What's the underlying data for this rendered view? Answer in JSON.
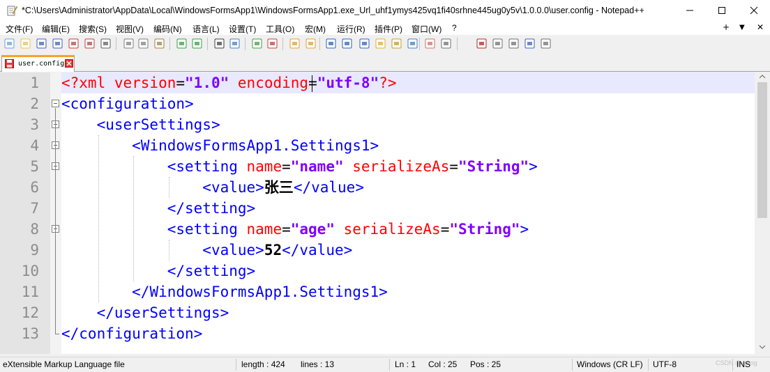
{
  "window": {
    "title": "*C:\\Users\\Administrator\\AppData\\Local\\WindowsFormsApp1\\WindowsFormsApp1.exe_Url_uhf1ymys425vq1fi40srhne445ug0y5v\\1.0.0.0\\user.config - Notepad++"
  },
  "menu": {
    "items": [
      "文件(F)",
      "编辑(E)",
      "搜索(S)",
      "视图(V)",
      "编码(N)",
      "语言(L)",
      "设置(T)",
      "工具(O)",
      "宏(M)",
      "运行(R)",
      "插件(P)",
      "窗口(W)",
      "?"
    ],
    "right_plus": "+",
    "right_arrow": "▼",
    "right_close": "✕"
  },
  "toolbar": {
    "icons": [
      "new-file-icon",
      "open-file-icon",
      "save-icon",
      "save-all-icon",
      "close-icon",
      "close-all-icon",
      "print-icon",
      "cut-icon",
      "copy-icon",
      "paste-icon",
      "undo-icon",
      "redo-icon",
      "find-icon",
      "replace-icon",
      "zoom-in-icon",
      "zoom-out-icon",
      "sync-vertical-icon",
      "sync-horizontal-icon",
      "word-wrap-icon",
      "show-all-chars-icon",
      "indent-guide-icon",
      "user-lang-icon",
      "doc-map-icon",
      "function-list-icon",
      "folder-workspace-icon",
      "monitoring-icon",
      "record-macro-icon",
      "stop-macro-icon",
      "play-macro-icon",
      "run-macro-multiple-icon",
      "save-macro-icon"
    ]
  },
  "tab": {
    "label": "user.config",
    "modified": true
  },
  "editor": {
    "line_numbers": [
      "1",
      "2",
      "3",
      "4",
      "5",
      "6",
      "7",
      "8",
      "9",
      "10",
      "11",
      "12",
      "13"
    ],
    "current_line": 1,
    "lines": [
      [
        [
          "a",
          "<?xml "
        ],
        [
          "a",
          "version"
        ],
        [
          "d",
          "="
        ],
        [
          "v",
          "\"1.0\""
        ],
        [
          "d",
          " "
        ],
        [
          "a",
          "enco"
        ],
        [
          "a",
          "ding"
        ],
        [
          "d",
          "="
        ],
        [
          "v",
          "\"utf-8\""
        ],
        [
          "a",
          "?>"
        ]
      ],
      [
        [
          "t",
          "<configuration>"
        ]
      ],
      [
        [
          "d",
          "    "
        ],
        [
          "t",
          "<userSettings>"
        ]
      ],
      [
        [
          "d",
          "        "
        ],
        [
          "t",
          "<WindowsFormsApp1.Settings1>"
        ]
      ],
      [
        [
          "d",
          "            "
        ],
        [
          "t",
          "<setting "
        ],
        [
          "a",
          "name"
        ],
        [
          "d",
          "="
        ],
        [
          "v",
          "\"name\""
        ],
        [
          "d",
          " "
        ],
        [
          "a",
          "serializeAs"
        ],
        [
          "d",
          "="
        ],
        [
          "v",
          "\"String\""
        ],
        [
          "t",
          ">"
        ]
      ],
      [
        [
          "d",
          "                "
        ],
        [
          "t",
          "<value>"
        ],
        [
          "x",
          "张三"
        ],
        [
          "t",
          "</value>"
        ]
      ],
      [
        [
          "d",
          "            "
        ],
        [
          "t",
          "</setting>"
        ]
      ],
      [
        [
          "d",
          "            "
        ],
        [
          "t",
          "<setting "
        ],
        [
          "a",
          "name"
        ],
        [
          "d",
          "="
        ],
        [
          "v",
          "\"age\""
        ],
        [
          "d",
          " "
        ],
        [
          "a",
          "serializeAs"
        ],
        [
          "d",
          "="
        ],
        [
          "v",
          "\"String\""
        ],
        [
          "t",
          ">"
        ]
      ],
      [
        [
          "d",
          "                "
        ],
        [
          "t",
          "<value>"
        ],
        [
          "x",
          "52"
        ],
        [
          "t",
          "</value>"
        ]
      ],
      [
        [
          "d",
          "            "
        ],
        [
          "t",
          "</setting>"
        ]
      ],
      [
        [
          "d",
          "        "
        ],
        [
          "t",
          "</WindowsFormsApp1.Settings1>"
        ]
      ],
      [
        [
          "d",
          "    "
        ],
        [
          "t",
          "</userSettings>"
        ]
      ],
      [
        [
          "t",
          "</configuration>"
        ]
      ]
    ]
  },
  "status": {
    "file_type": "eXtensible Markup Language file",
    "length": "length : 424",
    "lines": "lines : 13",
    "ln": "Ln : 1",
    "col": "Col : 25",
    "pos": "Pos : 25",
    "eol": "Windows (CR LF)",
    "encoding": "UTF-8",
    "mode": "INS",
    "watermark": "CSDN @eatog"
  },
  "colors": {
    "tag": "#0000ff",
    "attr": "#ff0000",
    "value": "#8000ff",
    "current_line": "#e8e8ff",
    "tab_accent": "#f7a326"
  }
}
